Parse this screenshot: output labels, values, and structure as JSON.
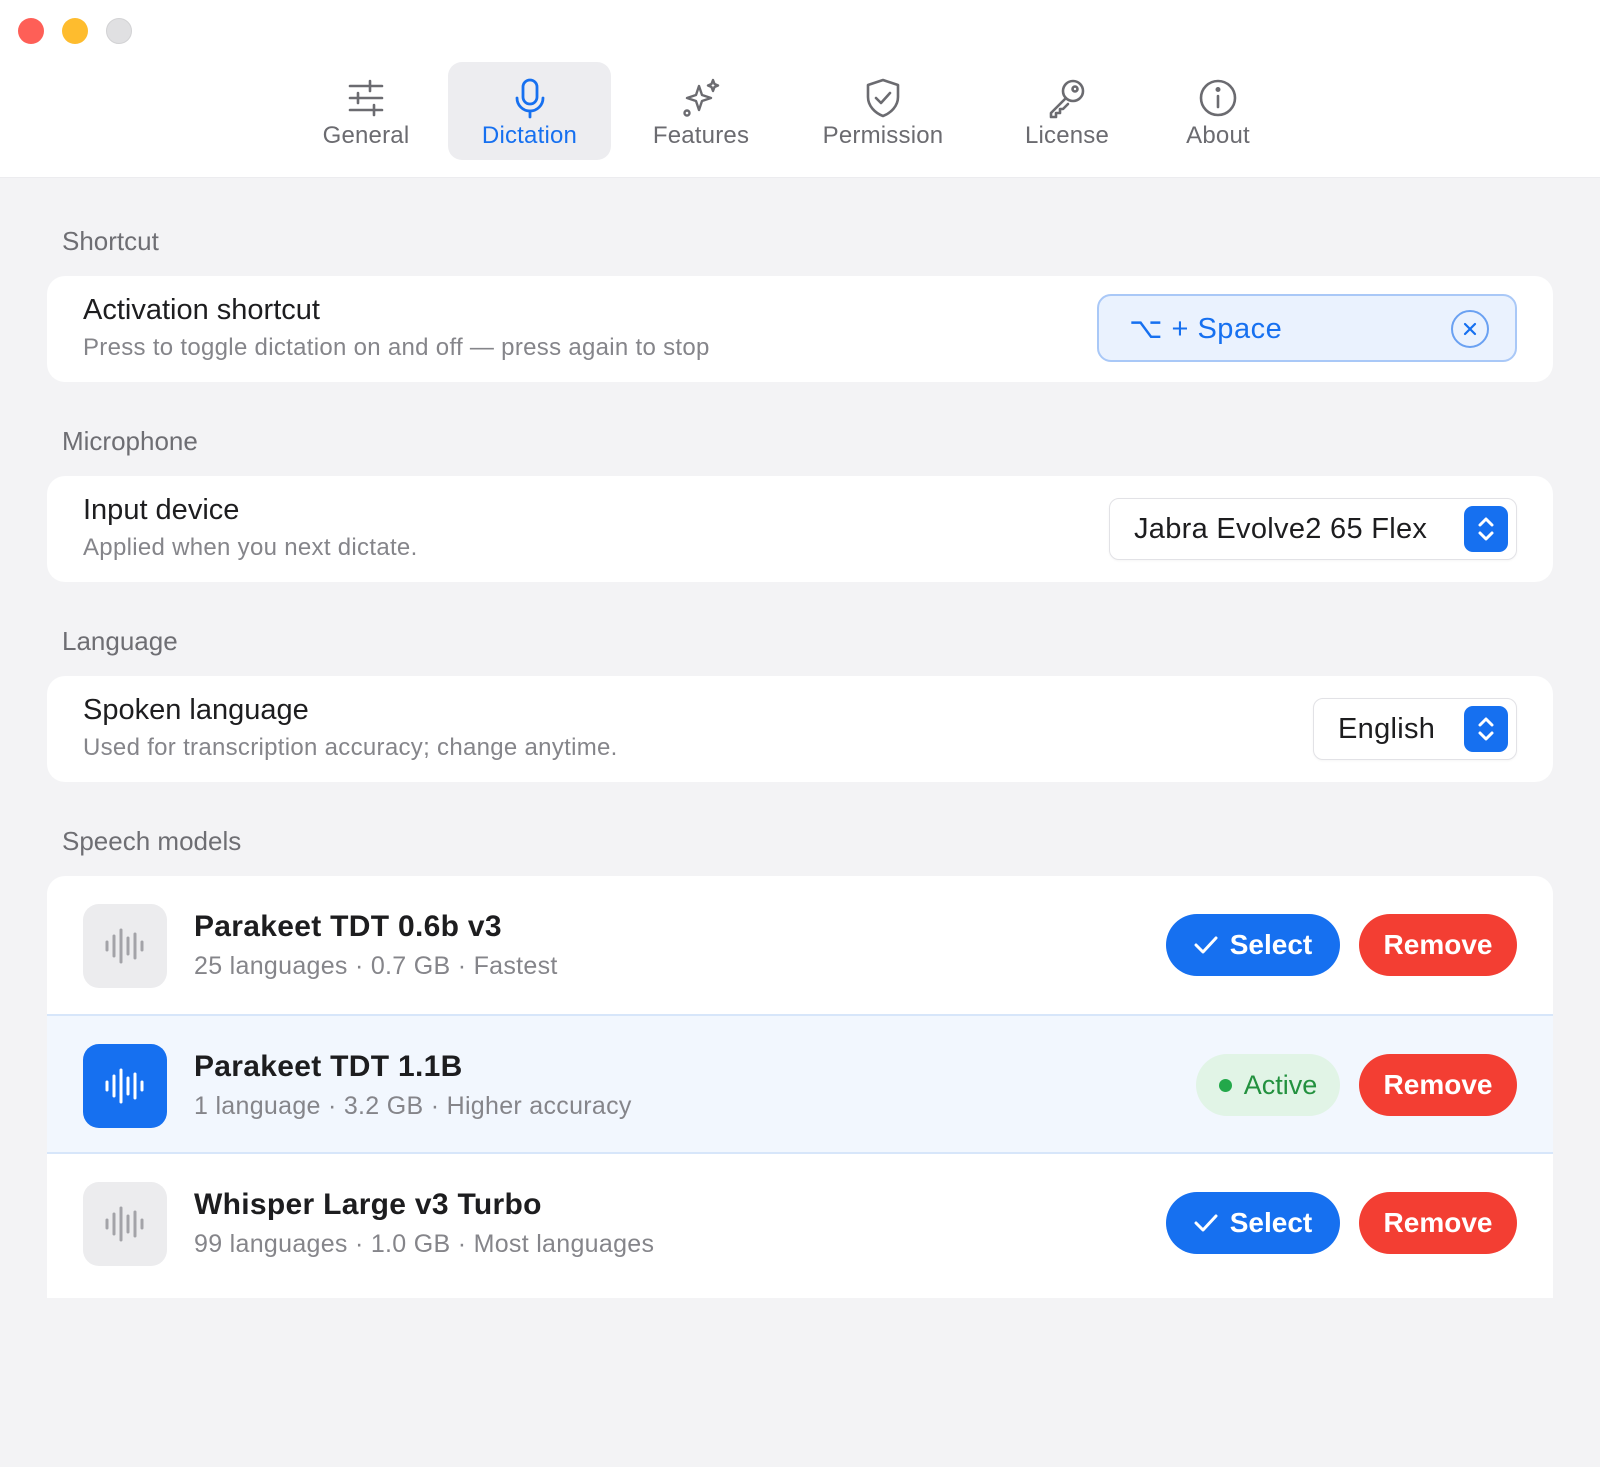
{
  "window": {
    "controls": [
      "close",
      "minimize",
      "zoom"
    ]
  },
  "tabs": [
    {
      "label": "General",
      "icon": "sliders-icon",
      "active": false
    },
    {
      "label": "Dictation",
      "icon": "microphone-icon",
      "active": true
    },
    {
      "label": "Features",
      "icon": "sparkles-icon",
      "active": false
    },
    {
      "label": "Permission",
      "icon": "shield-check-icon",
      "active": false
    },
    {
      "label": "License",
      "icon": "key-icon",
      "active": false
    },
    {
      "label": "About",
      "icon": "info-icon",
      "active": false
    }
  ],
  "sections": {
    "shortcut": {
      "title": "Shortcut",
      "row_title": "Activation shortcut",
      "row_subtitle": "Press to toggle dictation on and off — press again to stop",
      "value": "⌥ + Space"
    },
    "microphone": {
      "title": "Microphone",
      "row_title": "Input device",
      "row_subtitle": "Applied when you next dictate.",
      "value": "Jabra Evolve2 65 Flex"
    },
    "language": {
      "title": "Language",
      "row_title": "Spoken language",
      "row_subtitle": "Used for transcription accuracy; change anytime.",
      "value": "English"
    },
    "models": {
      "title": "Speech models",
      "items": [
        {
          "name": "Parakeet TDT 0.6b v3",
          "meta": "25 languages · 0.7 GB · Fastest",
          "active": false,
          "select_label": "Select",
          "remove_label": "Remove"
        },
        {
          "name": "Parakeet TDT 1.1B",
          "meta": "1 language · 3.2 GB · Higher accuracy",
          "active": true,
          "status_label": "Active",
          "remove_label": "Remove"
        },
        {
          "name": "Whisper Large v3 Turbo",
          "meta": "99 languages · 1.0 GB · Most languages",
          "active": false,
          "select_label": "Select",
          "remove_label": "Remove"
        }
      ]
    }
  },
  "colors": {
    "accent": "#1670f0",
    "danger": "#f33e33",
    "success": "#23a84a",
    "background": "#f3f3f5",
    "card": "#ffffff"
  }
}
